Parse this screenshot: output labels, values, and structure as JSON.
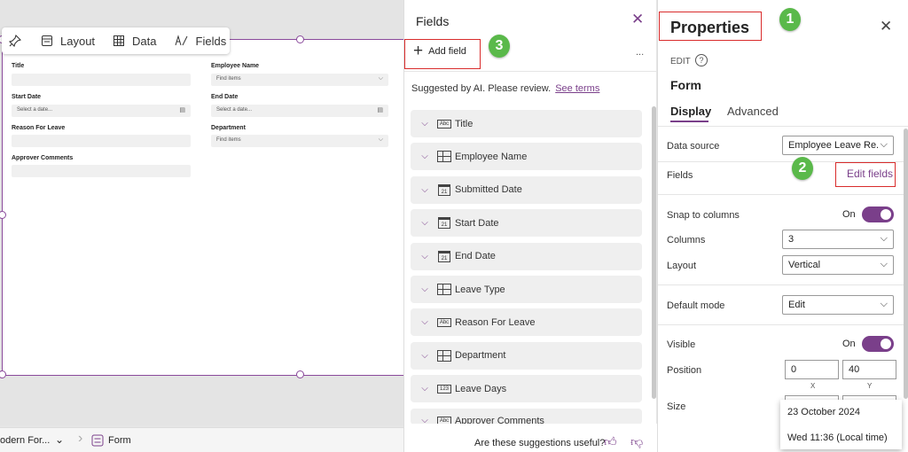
{
  "toolbar": {
    "layout": "Layout",
    "data": "Data",
    "fields": "Fields"
  },
  "form": {
    "fields": [
      {
        "label": "Title",
        "value": ""
      },
      {
        "label": "Employee Name",
        "value": "Find items"
      },
      {
        "label": "Start Date",
        "value": "Select a date..."
      },
      {
        "label": "End Date",
        "value": "Select a date..."
      },
      {
        "label": "Reason For Leave",
        "value": ""
      },
      {
        "label": "Department",
        "value": "Find items"
      },
      {
        "label": "Approver Comments",
        "value": ""
      }
    ]
  },
  "bottom": {
    "crumb1": "odern For...",
    "crumb2": "Form"
  },
  "fields_panel": {
    "title": "Fields",
    "add_field": "Add field",
    "more": "...",
    "suggested": "Suggested by AI. Please review.",
    "see_terms": "See terms",
    "items": [
      {
        "label": "Title",
        "type": "abc"
      },
      {
        "label": "Employee Name",
        "type": "grid"
      },
      {
        "label": "Submitted Date",
        "type": "cal"
      },
      {
        "label": "Start Date",
        "type": "cal"
      },
      {
        "label": "End Date",
        "type": "cal"
      },
      {
        "label": "Leave Type",
        "type": "grid"
      },
      {
        "label": "Reason For Leave",
        "type": "abc"
      },
      {
        "label": "Department",
        "type": "grid"
      },
      {
        "label": "Leave Days",
        "type": "123"
      },
      {
        "label": "Approver Comments",
        "type": "abc"
      }
    ],
    "feedback": "Are these suggestions useful?"
  },
  "properties": {
    "title": "Properties",
    "edit": "EDIT",
    "component": "Form",
    "tab_display": "Display",
    "tab_advanced": "Advanced",
    "data_source_label": "Data source",
    "data_source_value": "Employee Leave Re...",
    "fields_label": "Fields",
    "edit_fields": "Edit fields",
    "snap_label": "Snap to columns",
    "snap_value": "On",
    "columns_label": "Columns",
    "columns_value": "3",
    "layout_label": "Layout",
    "layout_value": "Vertical",
    "default_mode_label": "Default mode",
    "default_mode_value": "Edit",
    "visible_label": "Visible",
    "visible_value": "On",
    "position_label": "Position",
    "pos_x": "0",
    "pos_y": "40",
    "x_label": "X",
    "y_label": "Y",
    "size_label": "Size"
  },
  "tooltip": {
    "date": "23 October 2024",
    "time": "Wed 11:36 (Local time)"
  },
  "callouts": {
    "one": "1",
    "two": "2",
    "three": "3"
  },
  "colors": {
    "accent": "#7a3f8a",
    "callout": "#5ab94a",
    "highlight": "#d92c2c"
  }
}
